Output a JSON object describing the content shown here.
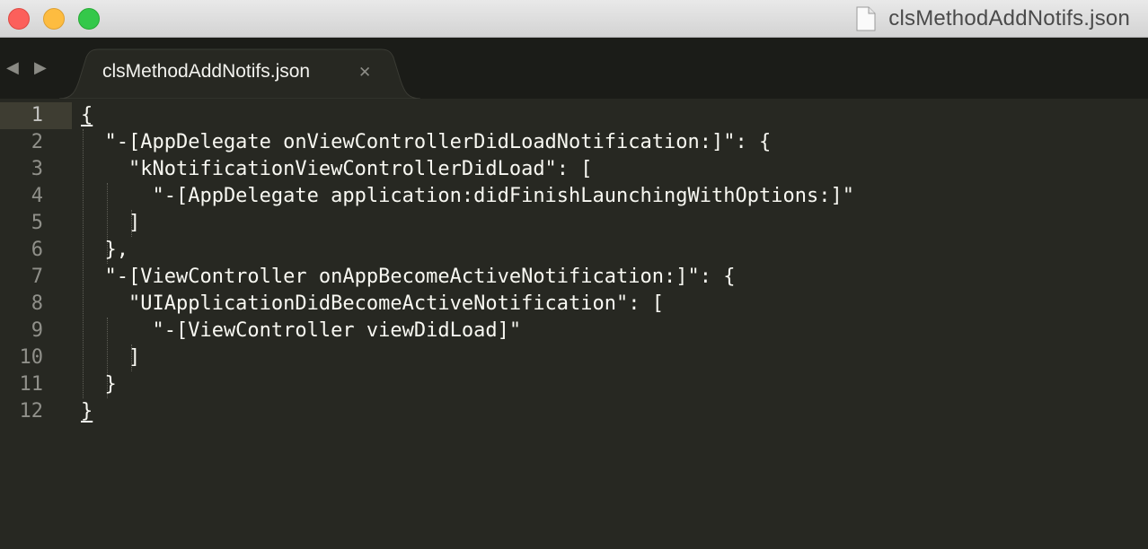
{
  "window": {
    "title": "clsMethodAddNotifs.json",
    "title_icon": "document-icon",
    "controls": [
      "close",
      "minimize",
      "zoom"
    ],
    "colors": {
      "close": "#fc605b",
      "minimize": "#fdbc40",
      "zoom": "#34c84a"
    }
  },
  "nav": {
    "back_icon": "◀",
    "forward_icon": "▶"
  },
  "tab": {
    "label": "clsMethodAddNotifs.json",
    "close_icon": "✕"
  },
  "editor": {
    "theme": {
      "background": "#272822",
      "text": "#f8f8f2",
      "line_number": "#90908a"
    },
    "current_line": 1,
    "lines": [
      {
        "number": "1",
        "text": "{"
      },
      {
        "number": "2",
        "text": "  \"-[AppDelegate onViewControllerDidLoadNotification:]\": {"
      },
      {
        "number": "3",
        "text": "    \"kNotificationViewControllerDidLoad\": ["
      },
      {
        "number": "4",
        "text": "      \"-[AppDelegate application:didFinishLaunchingWithOptions:]\""
      },
      {
        "number": "5",
        "text": "    ]"
      },
      {
        "number": "6",
        "text": "  },"
      },
      {
        "number": "7",
        "text": "  \"-[ViewController onAppBecomeActiveNotification:]\": {"
      },
      {
        "number": "8",
        "text": "    \"UIApplicationDidBecomeActiveNotification\": ["
      },
      {
        "number": "9",
        "text": "      \"-[ViewController viewDidLoad]\""
      },
      {
        "number": "10",
        "text": "    ]"
      },
      {
        "number": "11",
        "text": "  }"
      },
      {
        "number": "12",
        "text": "}"
      }
    ]
  }
}
